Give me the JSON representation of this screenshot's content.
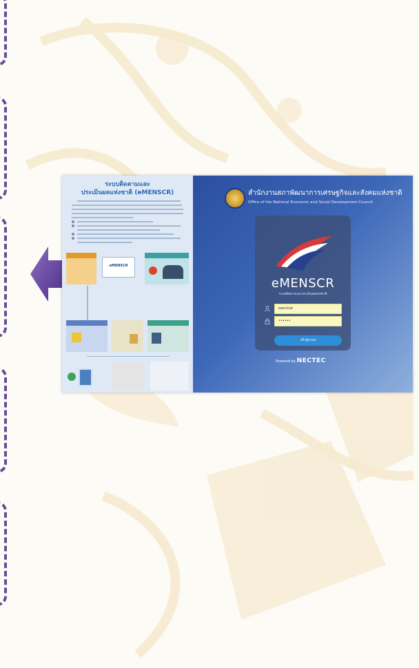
{
  "left_pane": {
    "title_line1": "ระบบติดตามและ",
    "title_line2": "ประเมินผลแห่งชาติ (eMENSCR)",
    "card1_label": "eMENSCR"
  },
  "org": {
    "name_th": "สำนักงานสภาพัฒนาการเศรษฐกิจและสังคมแห่งชาติ",
    "name_en": "Office of the National Economic and Social Development Council"
  },
  "login": {
    "app_name": "eMENSCR",
    "app_subtitle": "ระบบติดตามและประเมินผลแห่งชาติ",
    "username_value": "wanchat",
    "password_value": "••••••",
    "submit_label": "เข้าสู่ระบบ"
  },
  "footer": {
    "powered_prefix": "Powered by",
    "powered_brand": "NECTEC"
  },
  "colors": {
    "accent_purple": "#6a4a9a",
    "login_button": "#2e8fd8",
    "field_bg": "#fbf7c2"
  }
}
